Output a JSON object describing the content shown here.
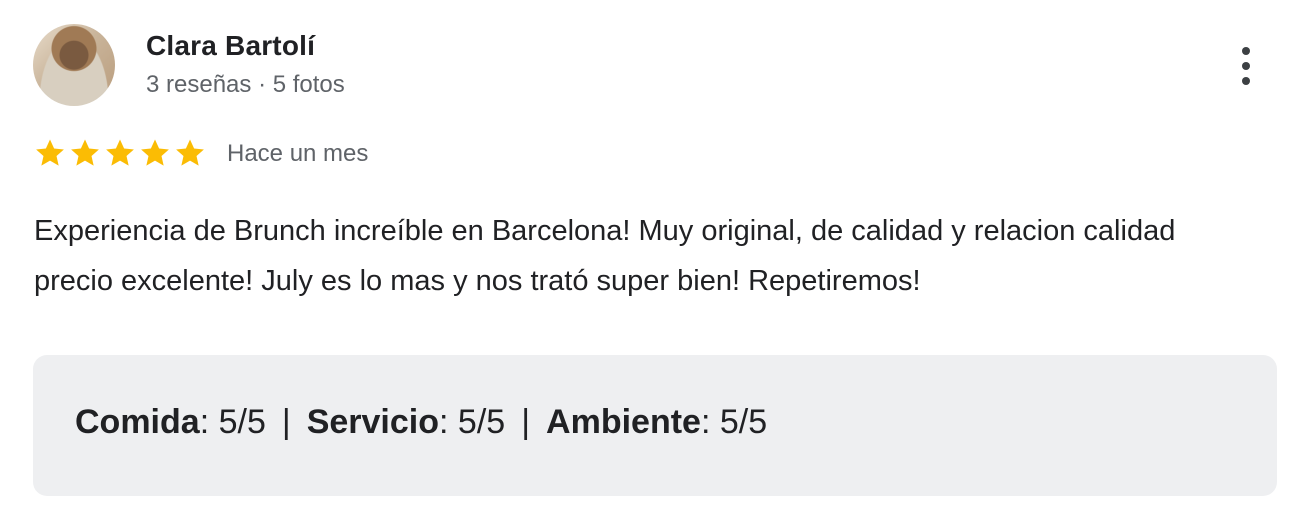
{
  "author": {
    "name": "Clara Bartolí",
    "meta": "3 reseñas · 5 fotos"
  },
  "review": {
    "rating": 5,
    "rating_max": 5,
    "star_color": "#fbbc04",
    "date": "Hace un mes",
    "text": "Experiencia de Brunch increíble en Barcelona! Muy original, de calidad y relacion calidad precio excelente! July es lo mas y nos trató super bien! Repetiremos!"
  },
  "ratings": {
    "separator": "|",
    "items": [
      {
        "label": "Comida",
        "value": "5/5"
      },
      {
        "label": "Servicio",
        "value": "5/5"
      },
      {
        "label": "Ambiente",
        "value": "5/5"
      }
    ]
  },
  "icons": {
    "more": "more-vert-icon",
    "star": "star-icon"
  }
}
